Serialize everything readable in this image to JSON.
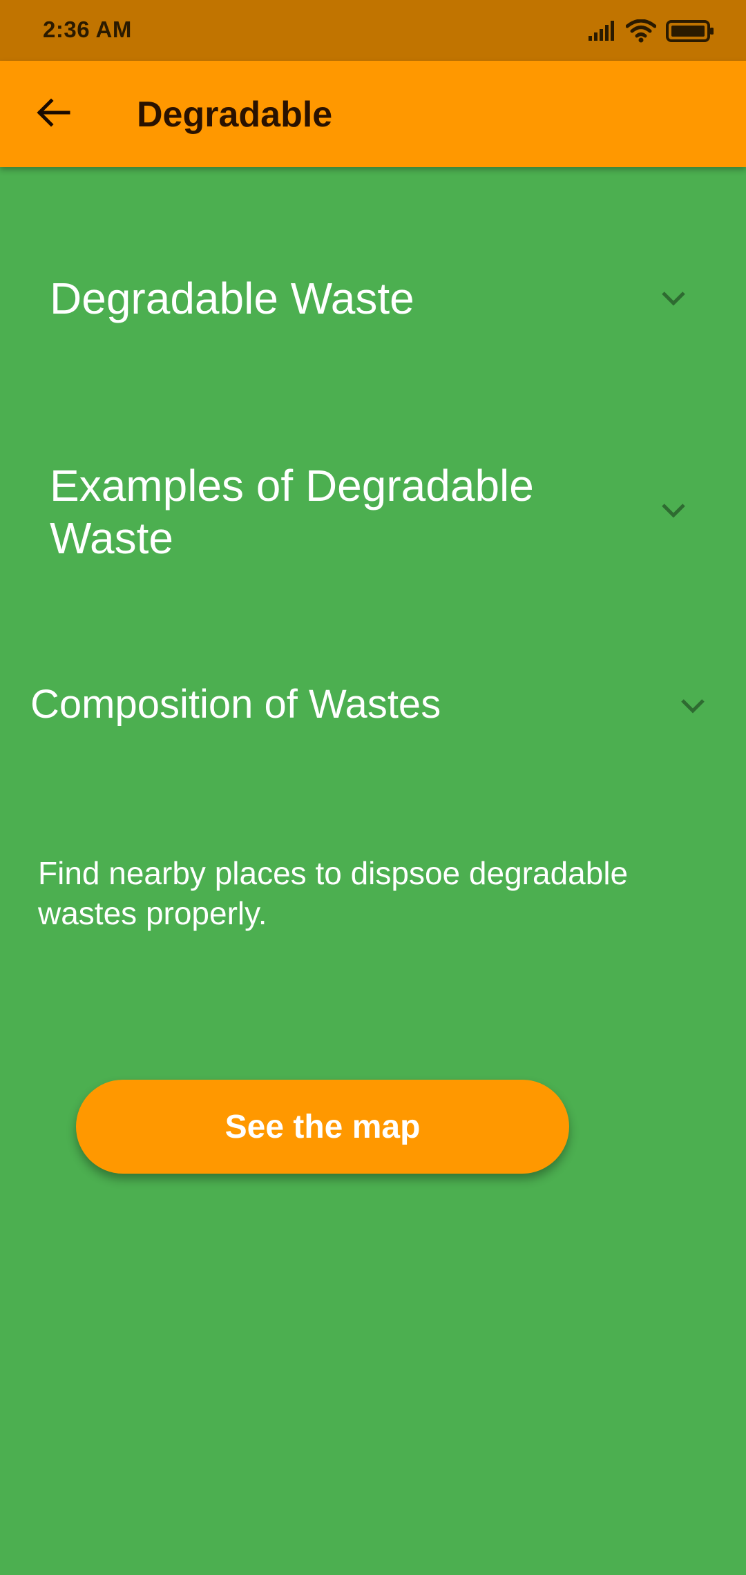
{
  "status_bar": {
    "time": "2:36 AM",
    "icons": [
      "signal-icon",
      "wifi-icon",
      "battery-icon"
    ]
  },
  "app_bar": {
    "back_icon": "arrow-left-icon",
    "title": "Degradable"
  },
  "sections": [
    {
      "title": "Degradable Waste",
      "icon": "chevron-down-icon"
    },
    {
      "title": "Examples of Degradable Waste",
      "icon": "chevron-down-icon"
    },
    {
      "title": "Composition of Wastes",
      "icon": "chevron-down-icon"
    }
  ],
  "info": {
    "text": "Find nearby places to dispsoe degradable wastes properly."
  },
  "map_button": {
    "label": "See the map"
  },
  "colors": {
    "status_bar": "#c17400",
    "app_bar": "#ff9800",
    "background": "#4caf50",
    "button": "#ff9800",
    "text": "#ffffff",
    "chevron": "#2e6b31"
  }
}
